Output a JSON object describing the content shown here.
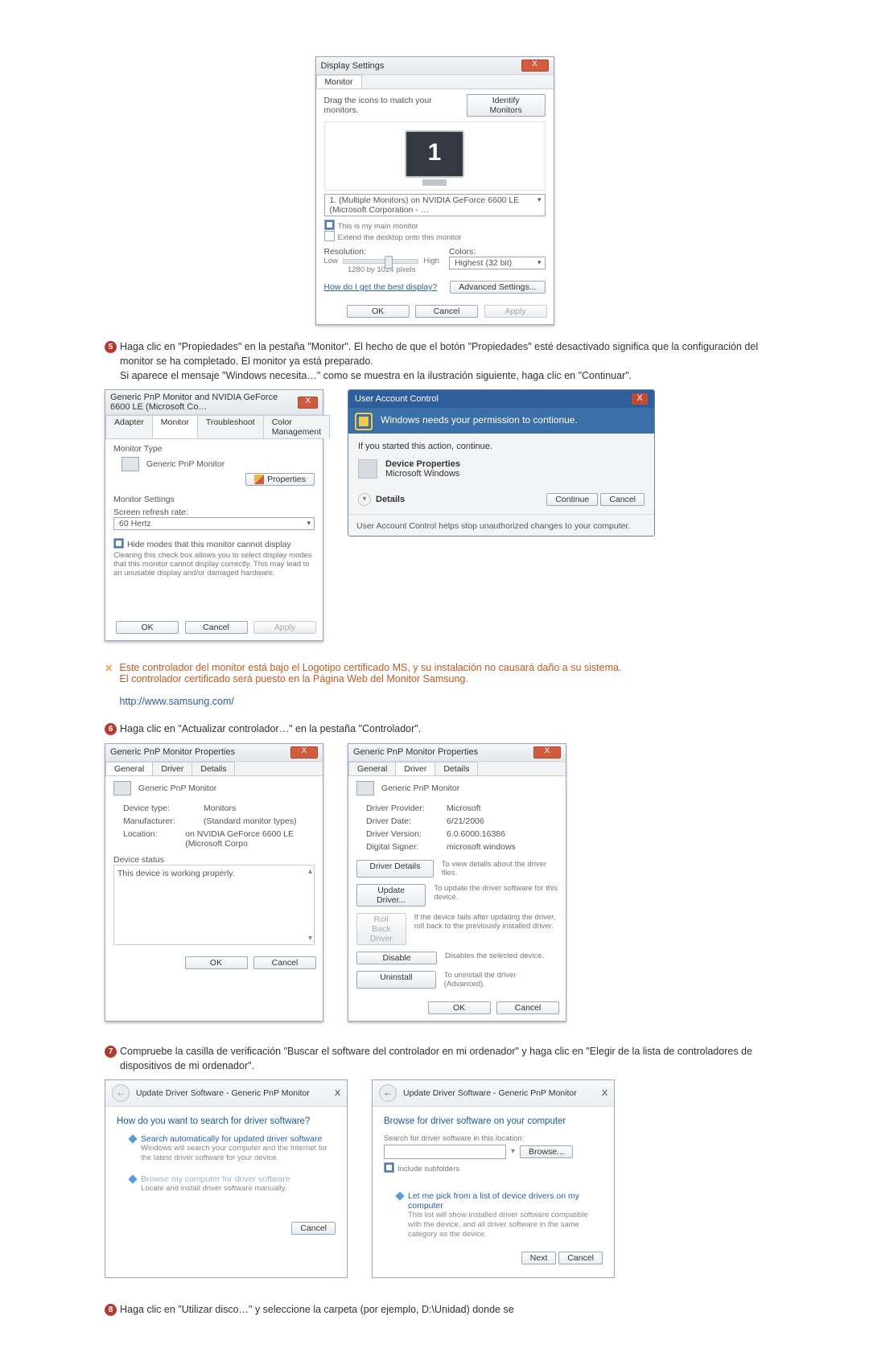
{
  "display_settings_dialog": {
    "title": "Display Settings",
    "tab_monitor": "Monitor",
    "close_x": "X",
    "drag_hint": "Drag the icons to match your monitors.",
    "identify_btn": "Identify Monitors",
    "dropdown_monitor": "1. (Multiple Monitors) on NVIDIA GeForce 6600 LE (Microsoft Corporation - …",
    "chk_main": "This is my main monitor",
    "chk_extend": "Extend the desktop onto this monitor",
    "resolution_label": "Resolution:",
    "res_low": "Low",
    "res_high": "High",
    "res_value": "1280 by 1024 pixels",
    "colors_label": "Colors:",
    "colors_value": "Highest (32 bit)",
    "best_link": "How do I get the best display?",
    "adv_btn": "Advanced Settings...",
    "ok": "OK",
    "cancel": "Cancel",
    "apply": "Apply"
  },
  "step5": {
    "num": "5",
    "p1": "Haga clic en \"Propiedades\" en la pestaña \"Monitor\". El hecho de que el botón \"Propiedades\" esté desactivado significa que la configuración del monitor se ha completado. El monitor ya está preparado.",
    "p2": "Si aparece el mensaje \"Windows necesita…\" como se muestra en la ilustración siguiente, haga clic en  \"Continuar\"."
  },
  "monitor_props_dialog": {
    "title": "Generic PnP Monitor and NVIDIA GeForce 6600 LE (Microsoft Co…",
    "tabs": {
      "adapter": "Adapter",
      "monitor": "Monitor",
      "troubleshoot": "Troubleshoot",
      "color": "Color Management"
    },
    "monitor_type_label": "Monitor Type",
    "monitor_name": "Generic PnP Monitor",
    "properties_btn": "Properties",
    "monitor_settings_label": "Monitor Settings",
    "refresh_label": "Screen refresh rate:",
    "refresh_value": "60 Hertz",
    "hide_modes_chk": "Hide modes that this monitor cannot display",
    "hide_modes_desc": "Clearing this check box allows you to select display modes that this monitor cannot display correctly. This may lead to an unusable display and/or damaged hardware.",
    "ok": "OK",
    "cancel": "Cancel",
    "apply": "Apply"
  },
  "uac_dialog": {
    "title": "User Account Control",
    "banner": "Windows needs your permission to contionue.",
    "started": "If you started this action, continue.",
    "l1": "Device Properties",
    "l2": "Microsoft Windows",
    "details": "Details",
    "continue_btn": "Continue",
    "cancel_btn": "Cancel",
    "footer": "User Account Control helps stop unauthorized changes to your computer."
  },
  "cert_note": {
    "line1": "Este controlador del monitor está bajo el Logotipo certificado MS, y su instalación no causará daño a su sistema.",
    "line2": "El controlador certificado será puesto en la Página Web del Monitor Samsung.",
    "link": "http://www.samsung.com/"
  },
  "step6": {
    "num": "6",
    "text": "Haga clic en \"Actualizar controlador…\" en la pestaña \"Controlador\"."
  },
  "driver_props_left": {
    "title": "Generic PnP Monitor Properties",
    "tabs": {
      "general": "General",
      "driver": "Driver",
      "details": "Details"
    },
    "name": "Generic PnP Monitor",
    "device_type_l": "Device type:",
    "device_type_v": "Monitors",
    "manufacturer_l": "Manufacturer:",
    "manufacturer_v": "(Standard monitor types)",
    "location_l": "Location:",
    "location_v": "on NVIDIA GeForce 6600 LE (Microsoft Corpo",
    "device_status_l": "Device status",
    "device_status_v": "This device is working properly.",
    "ok": "OK",
    "cancel": "Cancel"
  },
  "driver_props_right": {
    "title": "Generic PnP Monitor Properties",
    "tabs": {
      "general": "General",
      "driver": "Driver",
      "details": "Details"
    },
    "name": "Generic PnP Monitor",
    "provider_l": "Driver Provider:",
    "provider_v": "Microsoft",
    "date_l": "Driver Date:",
    "date_v": "6/21/2006",
    "version_l": "Driver Version:",
    "version_v": "6.0.6000.16386",
    "signer_l": "Digital Signer:",
    "signer_v": "microsoft windows",
    "btn_details": "Driver Details",
    "btn_details_d": "To view details about the driver files.",
    "btn_update": "Update Driver...",
    "btn_update_d": "To update the driver software for this device.",
    "btn_rollback": "Roll Back Driver",
    "btn_rollback_d": "If the device fails after updating the driver, roll back to the previously installed driver.",
    "btn_disable": "Disable",
    "btn_disable_d": "Disables the selected device.",
    "btn_uninstall": "Uninstall",
    "btn_uninstall_d": "To uninstall the driver (Advanced).",
    "ok": "OK",
    "cancel": "Cancel"
  },
  "step7": {
    "num": "7",
    "text": "Compruebe la casilla de verificación \"Buscar el software del controlador en mi ordenador\" y haga clic en \"Elegir de la lista de controladores de dispositivos de mi ordenador\"."
  },
  "wizard_left": {
    "crumb": "Update Driver Software - Generic PnP Monitor",
    "q": "How do you want to search for driver software?",
    "opt1_h": "Search automatically for updated driver software",
    "opt1_d": "Windows will search your computer and the Internet for the latest driver software for your device.",
    "opt2_h": "Browse my computer for driver software",
    "opt2_d": "Locate and install driver software manually.",
    "cancel": "Cancel"
  },
  "wizard_right": {
    "crumb": "Update Driver Software - Generic PnP Monitor",
    "h": "Browse for driver software on your computer",
    "search_l": "Search for driver software in this location:",
    "browse": "Browse...",
    "include": "Include subfolders",
    "opt_h": "Let me pick from a list of device drivers on my computer",
    "opt_d": "This list will show installed driver software compatible with the device, and all driver software in the same category as the device.",
    "next": "Next",
    "cancel": "Cancel"
  },
  "step8": {
    "num": "8",
    "text": "Haga clic en \"Utilizar disco…\" y seleccione la carpeta (por ejemplo, D:\\Unidad) donde se"
  }
}
